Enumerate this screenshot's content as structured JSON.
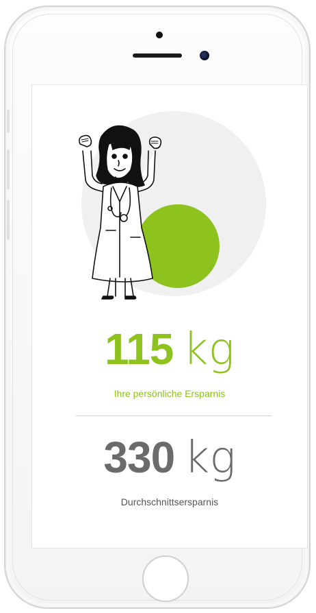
{
  "personal": {
    "value": "115",
    "unit": "kg",
    "caption": "Ihre persönliche Ersparnis"
  },
  "average": {
    "value": "330",
    "unit": "kg",
    "caption": "Durchschnittsersparnis"
  },
  "colors": {
    "accent": "#8dc21f",
    "neutral": "#6b6b6b",
    "circle_bg": "#f0f0f0"
  },
  "illustration": {
    "icon": "doctor-illustration-icon"
  }
}
